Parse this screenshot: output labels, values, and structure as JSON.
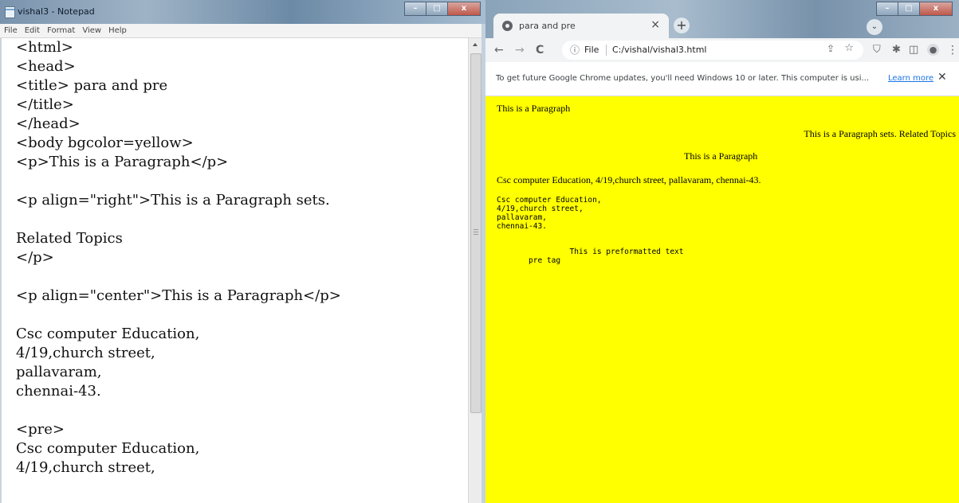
{
  "notepad": {
    "title": "vishal3 - Notepad",
    "window_controls": [
      "–",
      "□",
      "x"
    ],
    "menu": [
      "File",
      "Edit",
      "Format",
      "View",
      "Help"
    ],
    "lines": [
      "<html>",
      "<head>",
      "<title> para and pre",
      "</title>",
      "</head>",
      "<body bgcolor=yellow>",
      "<p>This is a Paragraph</p>",
      "",
      "<p align=\"right\">This is a Paragraph sets.",
      "",
      "Related Topics",
      "</p>",
      "",
      "<p align=\"center\">This is a Paragraph</p>",
      "",
      "Csc computer Education,",
      "4/19,church street,",
      "pallavaram,",
      "chennai-43.",
      "",
      "<pre>",
      "Csc computer Education,",
      "4/19,church street,"
    ]
  },
  "chrome": {
    "tab_title": "para and pre",
    "tab_close": "×",
    "new_tab": "+",
    "window_controls": [
      "–",
      "□",
      "x"
    ],
    "nav": {
      "back": "←",
      "forward": "→",
      "reload": "C"
    },
    "omnibox": {
      "scheme_label": "File",
      "url": "C:/vishal/vishal3.html"
    },
    "infobar": {
      "text": "To get future Google Chrome updates, you'll need Windows 10 or later. This computer is usi...",
      "link": "Learn more",
      "close": "✕"
    },
    "page": {
      "bg_color": "#ffff00",
      "p1": "This is a Paragraph",
      "p2": "This is a Paragraph sets. Related Topics",
      "p3": "This is a Paragraph",
      "p4": "Csc computer Education, 4/19,church street, pallavaram, chennai-43.",
      "pre1": "Csc computer Education,\n4/19,church street,\npallavaram,\nchennai-43.",
      "pre2": "                This is preformatted text\n       pre tag"
    }
  }
}
